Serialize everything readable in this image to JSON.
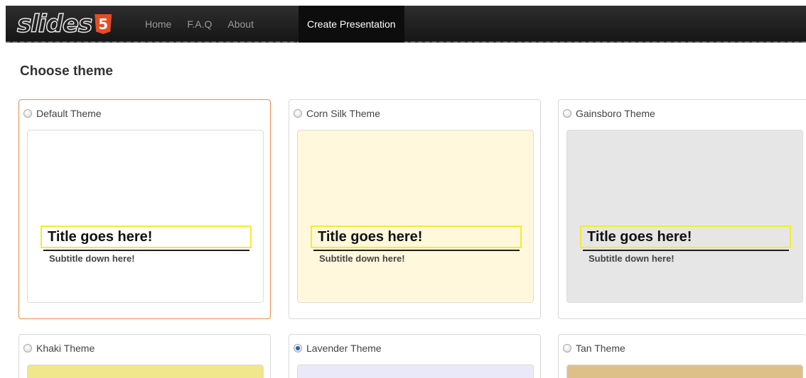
{
  "header": {
    "logo_text": "slides",
    "logo_badge": "5",
    "nav": [
      {
        "label": "Home"
      },
      {
        "label": "F.A.Q"
      },
      {
        "label": "About"
      }
    ],
    "create_label": "Create Presentation"
  },
  "page": {
    "title": "Choose theme"
  },
  "slide_sample": {
    "title": "Title goes here!",
    "subtitle": "Subtitle down here!"
  },
  "themes": [
    {
      "label": "Default Theme",
      "color": "#ffffff",
      "selected_border": true,
      "checked": false
    },
    {
      "label": "Corn Silk Theme",
      "color": "#fff8dc",
      "selected_border": false,
      "checked": false
    },
    {
      "label": "Gainsboro Theme",
      "color": "#e6e6e6",
      "selected_border": false,
      "checked": false
    },
    {
      "label": "Khaki Theme",
      "color": "#f0e68c",
      "selected_border": false,
      "checked": false
    },
    {
      "label": "Lavender Theme",
      "color": "#e9e9fa",
      "selected_border": false,
      "checked": true
    },
    {
      "label": "Tan Theme",
      "color": "#ddbf88",
      "selected_border": false,
      "checked": false
    }
  ]
}
